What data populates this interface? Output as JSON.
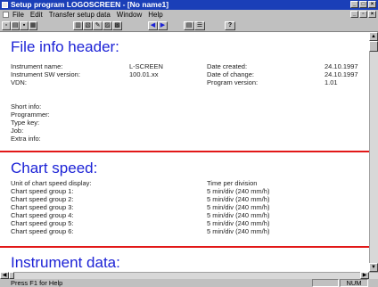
{
  "window": {
    "title": "Setup program LOGOSCREEN - [No name1]"
  },
  "menu": {
    "items": [
      "File",
      "Edit",
      "Transfer setup data",
      "Window",
      "Help"
    ]
  },
  "toolbar": {
    "help_label": "?"
  },
  "doc": {
    "header": {
      "title": "File info header:",
      "instrument_name_label": "Instrument name:",
      "instrument_name_value": "L-SCREEN",
      "sw_version_label": "Instrument SW version:",
      "sw_version_value": "100.01.xx",
      "vdn_label": "VDN:",
      "date_created_label": "Date created:",
      "date_created_value": "24.10.1997",
      "date_change_label": "Date of change:",
      "date_change_value": "24.10.1997",
      "program_version_label": "Program version:",
      "program_version_value": "1.01",
      "short_info_label": "Short info:",
      "programmer_label": "Programmer:",
      "type_key_label": "Type key:",
      "job_label": "Job:",
      "extra_info_label": "Extra info:"
    },
    "chart_speed": {
      "title": "Chart speed:",
      "unit_label": "Unit of chart speed display:",
      "unit_value": "Time per division",
      "groups": [
        {
          "label": "Chart speed group 1:",
          "value": "5 min/div (240 mm/h)"
        },
        {
          "label": "Chart speed group 2:",
          "value": "5 min/div (240 mm/h)"
        },
        {
          "label": "Chart speed group 3:",
          "value": "5 min/div (240 mm/h)"
        },
        {
          "label": "Chart speed group 4:",
          "value": "5 min/div (240 mm/h)"
        },
        {
          "label": "Chart speed group 5:",
          "value": "5 min/div (240 mm/h)"
        },
        {
          "label": "Chart speed group 6:",
          "value": "5 min/div (240 mm/h)"
        }
      ]
    },
    "instrument_data": {
      "title": "Instrument data:"
    }
  },
  "status": {
    "help_text": "Press F1 for Help",
    "num": "NUM"
  }
}
